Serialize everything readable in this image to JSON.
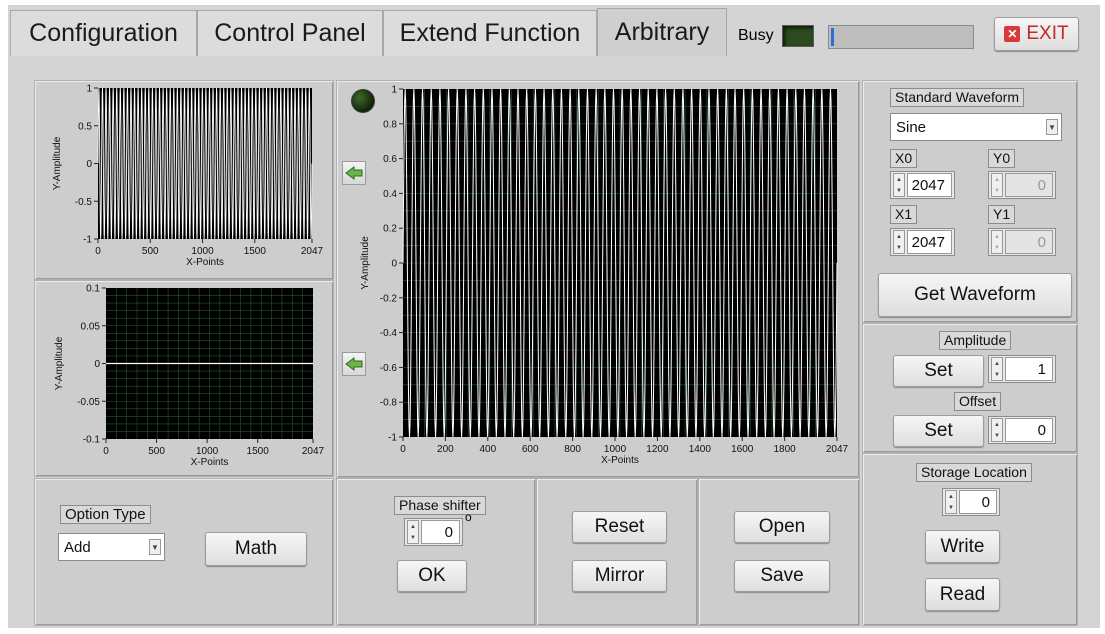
{
  "tabs": [
    {
      "label": "Configuration"
    },
    {
      "label": "Control Panel"
    },
    {
      "label": "Extend Function"
    },
    {
      "label": "Arbitrary"
    }
  ],
  "header": {
    "busy_label": "Busy",
    "exit_label": "EXIT",
    "busy_progress": 0.02
  },
  "plot_top": {
    "ylabel": "Y-Amplitude",
    "xlabel": "X-Points",
    "yticks": [
      "1",
      "0.5",
      "0",
      "-0.5",
      "-1"
    ],
    "xticks": [
      "0",
      "500",
      "1000",
      "1500",
      "2047"
    ]
  },
  "plot_bottom": {
    "ylabel": "Y-Amplitude",
    "xlabel": "X-Points",
    "yticks": [
      "0.1",
      "0.05",
      "0",
      "-0.05",
      "-0.1"
    ],
    "xticks": [
      "0",
      "500",
      "1000",
      "1500",
      "2047"
    ]
  },
  "plot_main": {
    "ylabel": "Y-Amplitude",
    "xlabel": "X-Points",
    "yticks": [
      "1",
      "0.8",
      "0.6",
      "0.4",
      "0.2",
      "0",
      "-0.2",
      "-0.4",
      "-0.6",
      "-0.8",
      "-1"
    ],
    "xticks": [
      "0",
      "200",
      "400",
      "600",
      "800",
      "1000",
      "1200",
      "1400",
      "1600",
      "1800",
      "2047"
    ]
  },
  "chart_data": [
    {
      "type": "line",
      "series": [
        {
          "shape": "sine",
          "cycles": 60,
          "amplitude": 1
        }
      ],
      "xlim": [
        0,
        2047
      ],
      "ylim": [
        -1,
        1
      ],
      "xlabel": "X-Points",
      "ylabel": "Y-Amplitude",
      "grid": false
    },
    {
      "type": "line",
      "series": [
        {
          "shape": "constant",
          "value": 0
        }
      ],
      "xlim": [
        0,
        2047
      ],
      "ylim": [
        -0.1,
        0.1
      ],
      "xlabel": "X-Points",
      "ylabel": "Y-Amplitude",
      "grid": true
    },
    {
      "type": "line",
      "series": [
        {
          "shape": "sine",
          "cycles": 50,
          "amplitude": 1
        }
      ],
      "xlim": [
        0,
        2047
      ],
      "ylim": [
        -1,
        1
      ],
      "xlabel": "X-Points",
      "ylabel": "Y-Amplitude",
      "grid": true
    }
  ],
  "right": {
    "standard_waveform_label": "Standard Waveform",
    "waveform_value": "Sine",
    "x0_label": "X0",
    "x0_value": "2047",
    "y0_label": "Y0",
    "y0_value": "0",
    "x1_label": "X1",
    "x1_value": "2047",
    "y1_label": "Y1",
    "y1_value": "0",
    "get_waveform_label": "Get Waveform",
    "amplitude_label": "Amplitude",
    "amplitude_set": "Set",
    "amplitude_value": "1",
    "offset_label": "Offset",
    "offset_set": "Set",
    "offset_value": "0",
    "storage_label": "Storage Location",
    "storage_value": "0",
    "write_label": "Write",
    "read_label": "Read"
  },
  "bottom": {
    "option_type_label": "Option Type",
    "option_value": "Add",
    "math_label": "Math",
    "phase_label": "Phase shifter",
    "phase_value": "0",
    "phase_unit": "o",
    "ok_label": "OK",
    "reset_label": "Reset",
    "mirror_label": "Mirror",
    "open_label": "Open",
    "save_label": "Save"
  },
  "colors": {
    "plot_bg": "#000000",
    "trace": "#ffffff",
    "grid": "#1f5a2a",
    "led": "#1e3a12",
    "panel": "#cdcdcd"
  },
  "icons": {
    "exit": "close-x-icon",
    "arrow": "left-arrow-icon",
    "led": "led-indicator-icon"
  }
}
